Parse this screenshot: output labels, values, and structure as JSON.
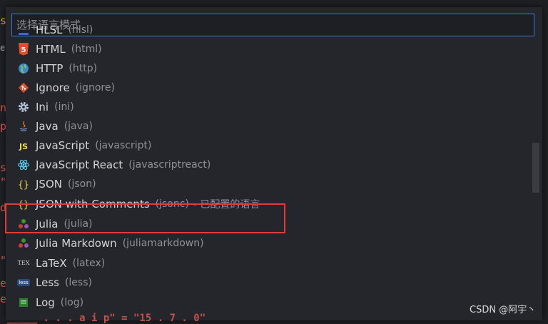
{
  "quick_pick": {
    "placeholder": "选择语言模式",
    "value": ""
  },
  "languages": [
    {
      "label": "HLSL",
      "id": "(hlsl)",
      "icon": "hlsl-icon"
    },
    {
      "label": "HTML",
      "id": "(html)",
      "icon": "html5-icon",
      "color": "#e44d26"
    },
    {
      "label": "HTTP",
      "id": "(http)",
      "icon": "globe-icon",
      "color": "#4a9fd8"
    },
    {
      "label": "Ignore",
      "id": "(ignore)",
      "icon": "git-icon",
      "color": "#e44d26"
    },
    {
      "label": "Ini",
      "id": "(ini)",
      "icon": "gear-icon",
      "color": "#b0c4d4"
    },
    {
      "label": "Java",
      "id": "(java)",
      "icon": "java-icon",
      "color": "#6f8fb8"
    },
    {
      "label": "JavaScript",
      "id": "(javascript)",
      "icon": "javascript-icon",
      "color": "#f0db4f"
    },
    {
      "label": "JavaScript React",
      "id": "(javascriptreact)",
      "icon": "react-icon",
      "color": "#61dafb"
    },
    {
      "label": "JSON",
      "id": "(json)",
      "icon": "braces-icon",
      "color": "#f0db4f"
    },
    {
      "label": "JSON with Comments",
      "id": "(jsonc)",
      "extra": "- 已配置的语言",
      "icon": "braces-icon",
      "color": "#f0db4f"
    },
    {
      "label": "Julia",
      "id": "(julia)",
      "icon": "julia-icon"
    },
    {
      "label": "Julia Markdown",
      "id": "(juliamarkdown)",
      "icon": "julia-icon"
    },
    {
      "label": "LaTeX",
      "id": "(latex)",
      "icon": "tex-icon",
      "icon_text": "TEX"
    },
    {
      "label": "Less",
      "id": "(less)",
      "icon": "less-icon",
      "icon_text": "less"
    },
    {
      "label": "Log",
      "id": "(log)",
      "icon": "log-icon",
      "color": "#4caf50"
    }
  ],
  "background_editor": {
    "left_chars": [
      "s",
      "e",
      "n",
      "p",
      "s",
      "\"",
      "d",
      "\"",
      "e",
      "e"
    ],
    "bottom_line": "_____ . . . a i p\" = \"15 . 7 . 0\""
  },
  "colors": {
    "selection_border": "#e23b3b",
    "focus_border": "#3c78d8"
  },
  "watermark": "CSDN @阿宇丶"
}
